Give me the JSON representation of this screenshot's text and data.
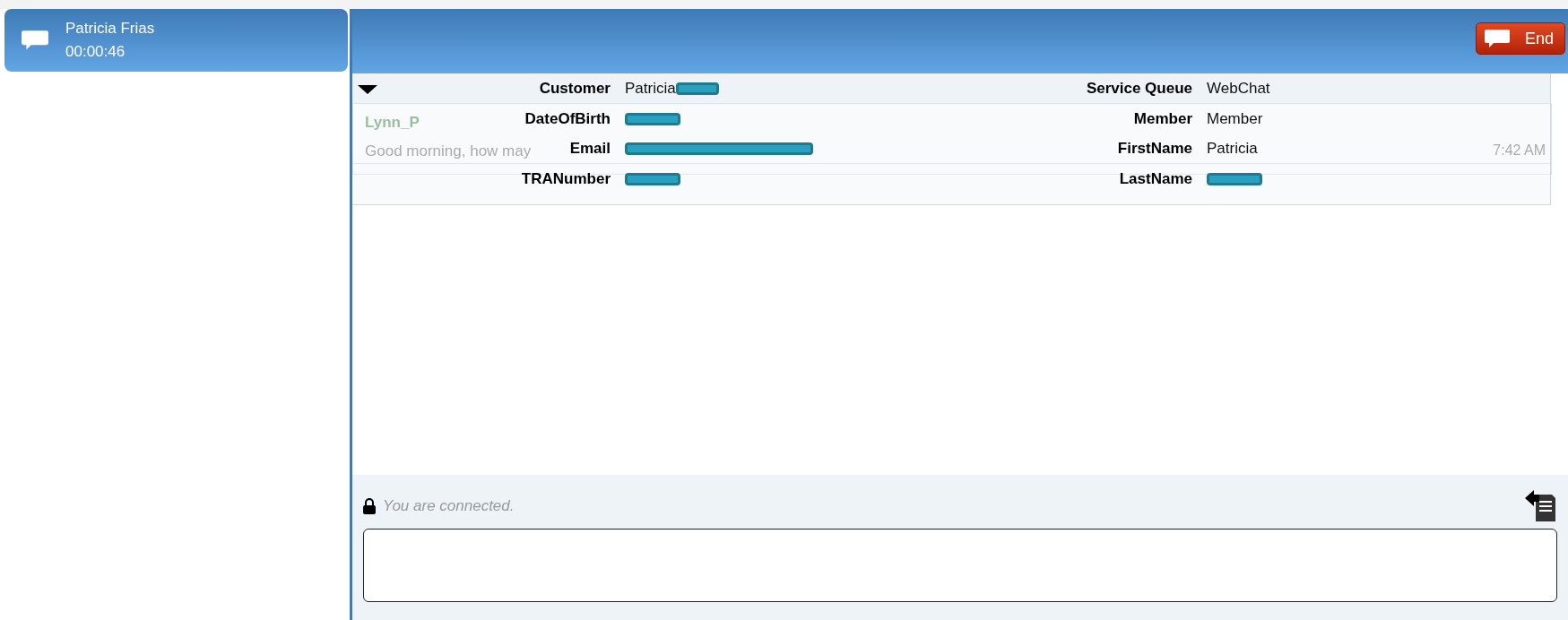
{
  "sessions": [
    {
      "name": "Patricia Frias",
      "timer": "00:00:46",
      "selected": true
    }
  ],
  "header": {
    "end_button": "End"
  },
  "info": {
    "expanded": true,
    "left": [
      {
        "label": "Customer",
        "value": "Patricia",
        "kind": "mixed"
      },
      {
        "label": "DateOfBirth",
        "kind": "masked"
      },
      {
        "label": "Email",
        "kind": "masked-wide"
      },
      {
        "label": "TRANumber",
        "kind": "masked"
      }
    ],
    "right": [
      {
        "label": "Service Queue",
        "value": "WebChat",
        "kind": "plain"
      },
      {
        "label": "Member",
        "value": "Member",
        "kind": "plain"
      },
      {
        "label": "FirstName",
        "value": "Patricia",
        "kind": "plain"
      },
      {
        "label": "LastName",
        "kind": "masked"
      }
    ]
  },
  "messages": [
    {
      "sender": "Lynn_P",
      "text": "Good morning, how may",
      "time": "7:42 AM"
    }
  ],
  "composer": {
    "status": "You are connected."
  }
}
